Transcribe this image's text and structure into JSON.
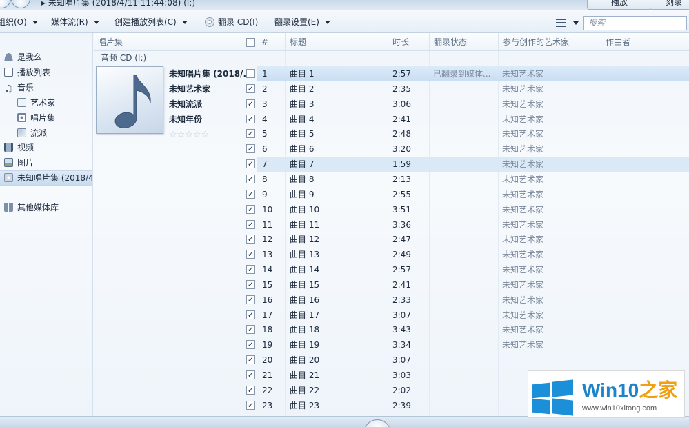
{
  "titlebar": {
    "breadcrumb": "▸ 未知唱片集 (2018/4/11 11:44:08) (I:)",
    "tab_play": "播放",
    "tab_burn": "刻录"
  },
  "toolbar": {
    "organize": "组织(O)",
    "stream": "媒体流(R)",
    "create_playlist": "创建播放列表(C)",
    "rip_cd": "翻录 CD(I)",
    "rip_settings": "翻录设置(E)",
    "search_placeholder": "搜索"
  },
  "leftnav": {
    "items": [
      {
        "label": "是我么",
        "icon": "user-icon"
      },
      {
        "label": "播放列表",
        "icon": "playlist-icon"
      },
      {
        "label": "音乐",
        "icon": "music-icon"
      },
      {
        "label": "艺术家",
        "icon": "artist-icon"
      },
      {
        "label": "唱片集",
        "icon": "album-icon"
      },
      {
        "label": "流派",
        "icon": "genre-icon"
      },
      {
        "label": "视频",
        "icon": "video-icon"
      },
      {
        "label": "图片",
        "icon": "picture-icon"
      },
      {
        "label": "未知唱片集 (2018/4",
        "icon": "cd-icon"
      },
      {
        "label": "其他媒体库",
        "icon": "other-library-icon"
      }
    ]
  },
  "columns": {
    "album": "唱片集",
    "num": "#",
    "title": "标题",
    "length": "时长",
    "rip_status": "翻录状态",
    "contributing_artist": "参与创作的艺术家",
    "composer": "作曲者"
  },
  "group": {
    "label": "音频 CD (I:)"
  },
  "album_info": {
    "title": "未知唱片集 (2018/...",
    "artist": "未知艺术家",
    "genre": "未知流派",
    "year": "未知年份",
    "rating_stars": "☆☆☆☆☆"
  },
  "tracks": [
    {
      "num": "1",
      "title": "曲目 1",
      "length": "2:57",
      "status": "已翻录到媒体...",
      "artist": "未知艺术家",
      "checked": false
    },
    {
      "num": "2",
      "title": "曲目 2",
      "length": "2:35",
      "status": "",
      "artist": "未知艺术家",
      "checked": true
    },
    {
      "num": "3",
      "title": "曲目 3",
      "length": "3:06",
      "status": "",
      "artist": "未知艺术家",
      "checked": true
    },
    {
      "num": "4",
      "title": "曲目 4",
      "length": "2:41",
      "status": "",
      "artist": "未知艺术家",
      "checked": true
    },
    {
      "num": "5",
      "title": "曲目 5",
      "length": "2:48",
      "status": "",
      "artist": "未知艺术家",
      "checked": true
    },
    {
      "num": "6",
      "title": "曲目 6",
      "length": "3:20",
      "status": "",
      "artist": "未知艺术家",
      "checked": true
    },
    {
      "num": "7",
      "title": "曲目 7",
      "length": "1:59",
      "status": "",
      "artist": "未知艺术家",
      "checked": true
    },
    {
      "num": "8",
      "title": "曲目 8",
      "length": "2:13",
      "status": "",
      "artist": "未知艺术家",
      "checked": true
    },
    {
      "num": "9",
      "title": "曲目 9",
      "length": "2:55",
      "status": "",
      "artist": "未知艺术家",
      "checked": true
    },
    {
      "num": "10",
      "title": "曲目 10",
      "length": "3:51",
      "status": "",
      "artist": "未知艺术家",
      "checked": true
    },
    {
      "num": "11",
      "title": "曲目 11",
      "length": "3:36",
      "status": "",
      "artist": "未知艺术家",
      "checked": true
    },
    {
      "num": "12",
      "title": "曲目 12",
      "length": "2:47",
      "status": "",
      "artist": "未知艺术家",
      "checked": true
    },
    {
      "num": "13",
      "title": "曲目 13",
      "length": "2:49",
      "status": "",
      "artist": "未知艺术家",
      "checked": true
    },
    {
      "num": "14",
      "title": "曲目 14",
      "length": "2:57",
      "status": "",
      "artist": "未知艺术家",
      "checked": true
    },
    {
      "num": "15",
      "title": "曲目 15",
      "length": "2:41",
      "status": "",
      "artist": "未知艺术家",
      "checked": true
    },
    {
      "num": "16",
      "title": "曲目 16",
      "length": "2:33",
      "status": "",
      "artist": "未知艺术家",
      "checked": true
    },
    {
      "num": "17",
      "title": "曲目 17",
      "length": "3:07",
      "status": "",
      "artist": "未知艺术家",
      "checked": true
    },
    {
      "num": "18",
      "title": "曲目 18",
      "length": "3:43",
      "status": "",
      "artist": "未知艺术家",
      "checked": true
    },
    {
      "num": "19",
      "title": "曲目 19",
      "length": "3:34",
      "status": "",
      "artist": "未知艺术家",
      "checked": true
    },
    {
      "num": "20",
      "title": "曲目 20",
      "length": "3:07",
      "status": "",
      "artist": "",
      "checked": true
    },
    {
      "num": "21",
      "title": "曲目 21",
      "length": "3:03",
      "status": "",
      "artist": "",
      "checked": true
    },
    {
      "num": "22",
      "title": "曲目 22",
      "length": "2:02",
      "status": "",
      "artist": "",
      "checked": true
    },
    {
      "num": "23",
      "title": "曲目 23",
      "length": "2:39",
      "status": "",
      "artist": "",
      "checked": true
    }
  ],
  "watermark": {
    "brand_main": "Win10",
    "brand_suffix": "之家",
    "url": "www.win10xitong.com"
  },
  "colors": {
    "accent": "#1b8fd8",
    "selection": "#c9def3"
  }
}
